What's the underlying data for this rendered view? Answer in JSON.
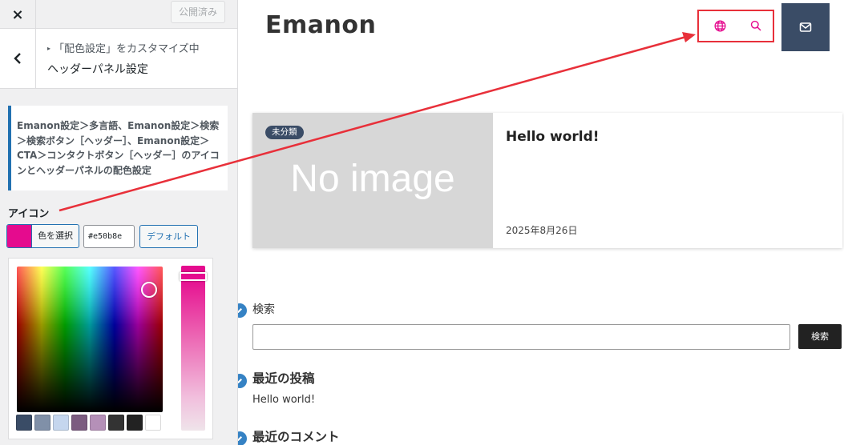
{
  "customizer": {
    "close_glyph": "×",
    "publish_label": "公開済み",
    "breadcrumb": "「配色設定」をカスタマイズ中",
    "panel_title": "ヘッダーパネル設定",
    "description": "Emanon設定＞多言語、Emanon設定＞検索＞検索ボタン［ヘッダー］、Emanon設定＞CTA＞コンタクトボタン［ヘッダー］のアイコンとヘッダーパネルの配色設定",
    "control_title": "アイコン",
    "select_color_label": "色を選択",
    "hex_value": "#e50b8e",
    "default_label": "デフォルト",
    "current_color": "#e50b8e",
    "palette": [
      "#3a4c66",
      "#8090a8",
      "#c5d6ee",
      "#7c5c80",
      "#b590b8",
      "#333333",
      "#222222",
      "#ffffff"
    ]
  },
  "preview": {
    "site_title": "Emanon",
    "icon_color": "#e50b8e",
    "header_button_color": "#3a4c66",
    "post": {
      "category": "未分類",
      "thumbnail_text": "No image",
      "title": "Hello world!",
      "date": "2025年8月26日"
    },
    "search_widget": {
      "title": "検索",
      "button_label": "検索"
    },
    "recent_posts": {
      "title": "最近の投稿",
      "items": [
        "Hello world!"
      ]
    },
    "recent_comments": {
      "title": "最近のコメント"
    }
  },
  "annotation": {
    "color": "#e8303a"
  }
}
